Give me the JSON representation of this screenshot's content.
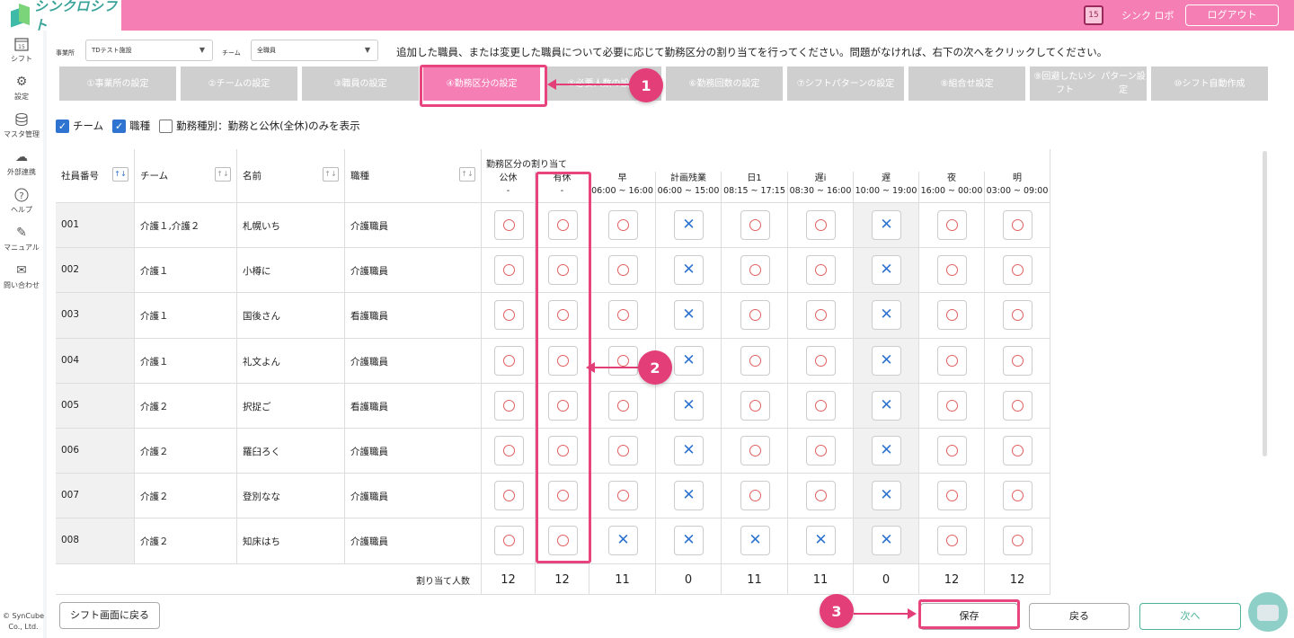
{
  "app": {
    "name": "シンクロシフト",
    "user": "シンク ロボ",
    "logout": "ログアウト",
    "calendar_day": "15"
  },
  "sidebar": [
    {
      "label": "シフト",
      "icon": "calendar-icon"
    },
    {
      "label": "設定",
      "icon": "gear-icon"
    },
    {
      "label": "マスタ管理",
      "icon": "database-icon"
    },
    {
      "label": "外部連携",
      "icon": "cloud-sync-icon"
    },
    {
      "label": "ヘルプ",
      "icon": "help-icon"
    },
    {
      "label": "マニュアル",
      "icon": "edit-icon"
    },
    {
      "label": "問い合わせ",
      "icon": "mail-icon"
    }
  ],
  "copyright": "© SynCube Co., Ltd.",
  "filters": {
    "office_label": "事業所",
    "office_value": "TDテスト施設",
    "team_label": "チーム",
    "team_value": "全職員"
  },
  "instruction": "追加した職員、または変更した職員について必要に応じて勤務区分の割り当てを行ってください。問題がなければ、右下の次へをクリックしてください。",
  "steps": [
    {
      "label": "①事業所の設定"
    },
    {
      "label": "②チームの設定"
    },
    {
      "label": "③職員の設定"
    },
    {
      "label": "④勤務区分の設定"
    },
    {
      "label": "⑤必要人数の設定"
    },
    {
      "label": "⑥勤務回数の設定"
    },
    {
      "label": "⑦シフト\nパターンの設定"
    },
    {
      "label": "⑧組合せ設定"
    },
    {
      "label": "⑨回避したいシフト\nパターン設定"
    },
    {
      "label": "⑩シフト自動作成"
    }
  ],
  "checkboxes": [
    {
      "label": "チーム",
      "checked": true
    },
    {
      "label": "職種",
      "checked": true
    },
    {
      "label": "勤務種別：勤務と公休(全休)のみを表示",
      "checked": false
    }
  ],
  "table": {
    "columns": {
      "id": "社員番号",
      "team": "チーム",
      "name": "名前",
      "job": "職種"
    },
    "assign_header": "勤務区分の割り当て",
    "shifts": [
      {
        "name": "公休",
        "time": "-"
      },
      {
        "name": "有休",
        "time": "-"
      },
      {
        "name": "早",
        "time": "06:00 ~ 16:00"
      },
      {
        "name": "計画残業",
        "time": "06:00 ~ 15:00"
      },
      {
        "name": "日1",
        "time": "08:15 ~ 17:15"
      },
      {
        "name": "遅i",
        "time": "08:30 ~ 16:00"
      },
      {
        "name": "遅",
        "time": "10:00 ~ 19:00"
      },
      {
        "name": "夜",
        "time": "16:00 ~ 00:00"
      },
      {
        "name": "明",
        "time": "03:00 ~ 09:00"
      }
    ],
    "rows": [
      {
        "id": "001",
        "team": "介護１,介護２",
        "name": "札幌いち",
        "job": "介護職員",
        "marks": [
          "o",
          "o",
          "o",
          "x",
          "o",
          "o",
          "x",
          "o",
          "o"
        ]
      },
      {
        "id": "002",
        "team": "介護１",
        "name": "小樽に",
        "job": "介護職員",
        "marks": [
          "o",
          "o",
          "o",
          "x",
          "o",
          "o",
          "x",
          "o",
          "o"
        ]
      },
      {
        "id": "003",
        "team": "介護１",
        "name": "国後さん",
        "job": "看護職員",
        "marks": [
          "o",
          "o",
          "o",
          "x",
          "o",
          "o",
          "x",
          "o",
          "o"
        ]
      },
      {
        "id": "004",
        "team": "介護１",
        "name": "礼文よん",
        "job": "介護職員",
        "marks": [
          "o",
          "o",
          "o",
          "x",
          "o",
          "o",
          "x",
          "o",
          "o"
        ]
      },
      {
        "id": "005",
        "team": "介護２",
        "name": "択捉ご",
        "job": "看護職員",
        "marks": [
          "o",
          "o",
          "o",
          "x",
          "o",
          "o",
          "x",
          "o",
          "o"
        ]
      },
      {
        "id": "006",
        "team": "介護２",
        "name": "羅臼ろく",
        "job": "介護職員",
        "marks": [
          "o",
          "o",
          "o",
          "x",
          "o",
          "o",
          "x",
          "o",
          "o"
        ]
      },
      {
        "id": "007",
        "team": "介護２",
        "name": "登別なな",
        "job": "介護職員",
        "marks": [
          "o",
          "o",
          "o",
          "x",
          "o",
          "o",
          "x",
          "o",
          "o"
        ]
      },
      {
        "id": "008",
        "team": "介護２",
        "name": "知床はち",
        "job": "介護職員",
        "marks": [
          "o",
          "o",
          "x",
          "x",
          "x",
          "x",
          "x",
          "o",
          "o"
        ]
      }
    ],
    "count_label": "割り当て人数",
    "counts": [
      "12",
      "12",
      "11",
      "0",
      "11",
      "11",
      "0",
      "12",
      "12"
    ]
  },
  "buttons": {
    "back_to_shift": "シフト画面に戻る",
    "save": "保存",
    "back": "戻る",
    "next": "次へ"
  },
  "annotations": [
    "1",
    "2",
    "3"
  ],
  "colors": {
    "header": "#f57fb4",
    "accent": "#e33e77",
    "circle": "#e06060",
    "cross": "#2f74d0",
    "next": "#4cb39a"
  }
}
